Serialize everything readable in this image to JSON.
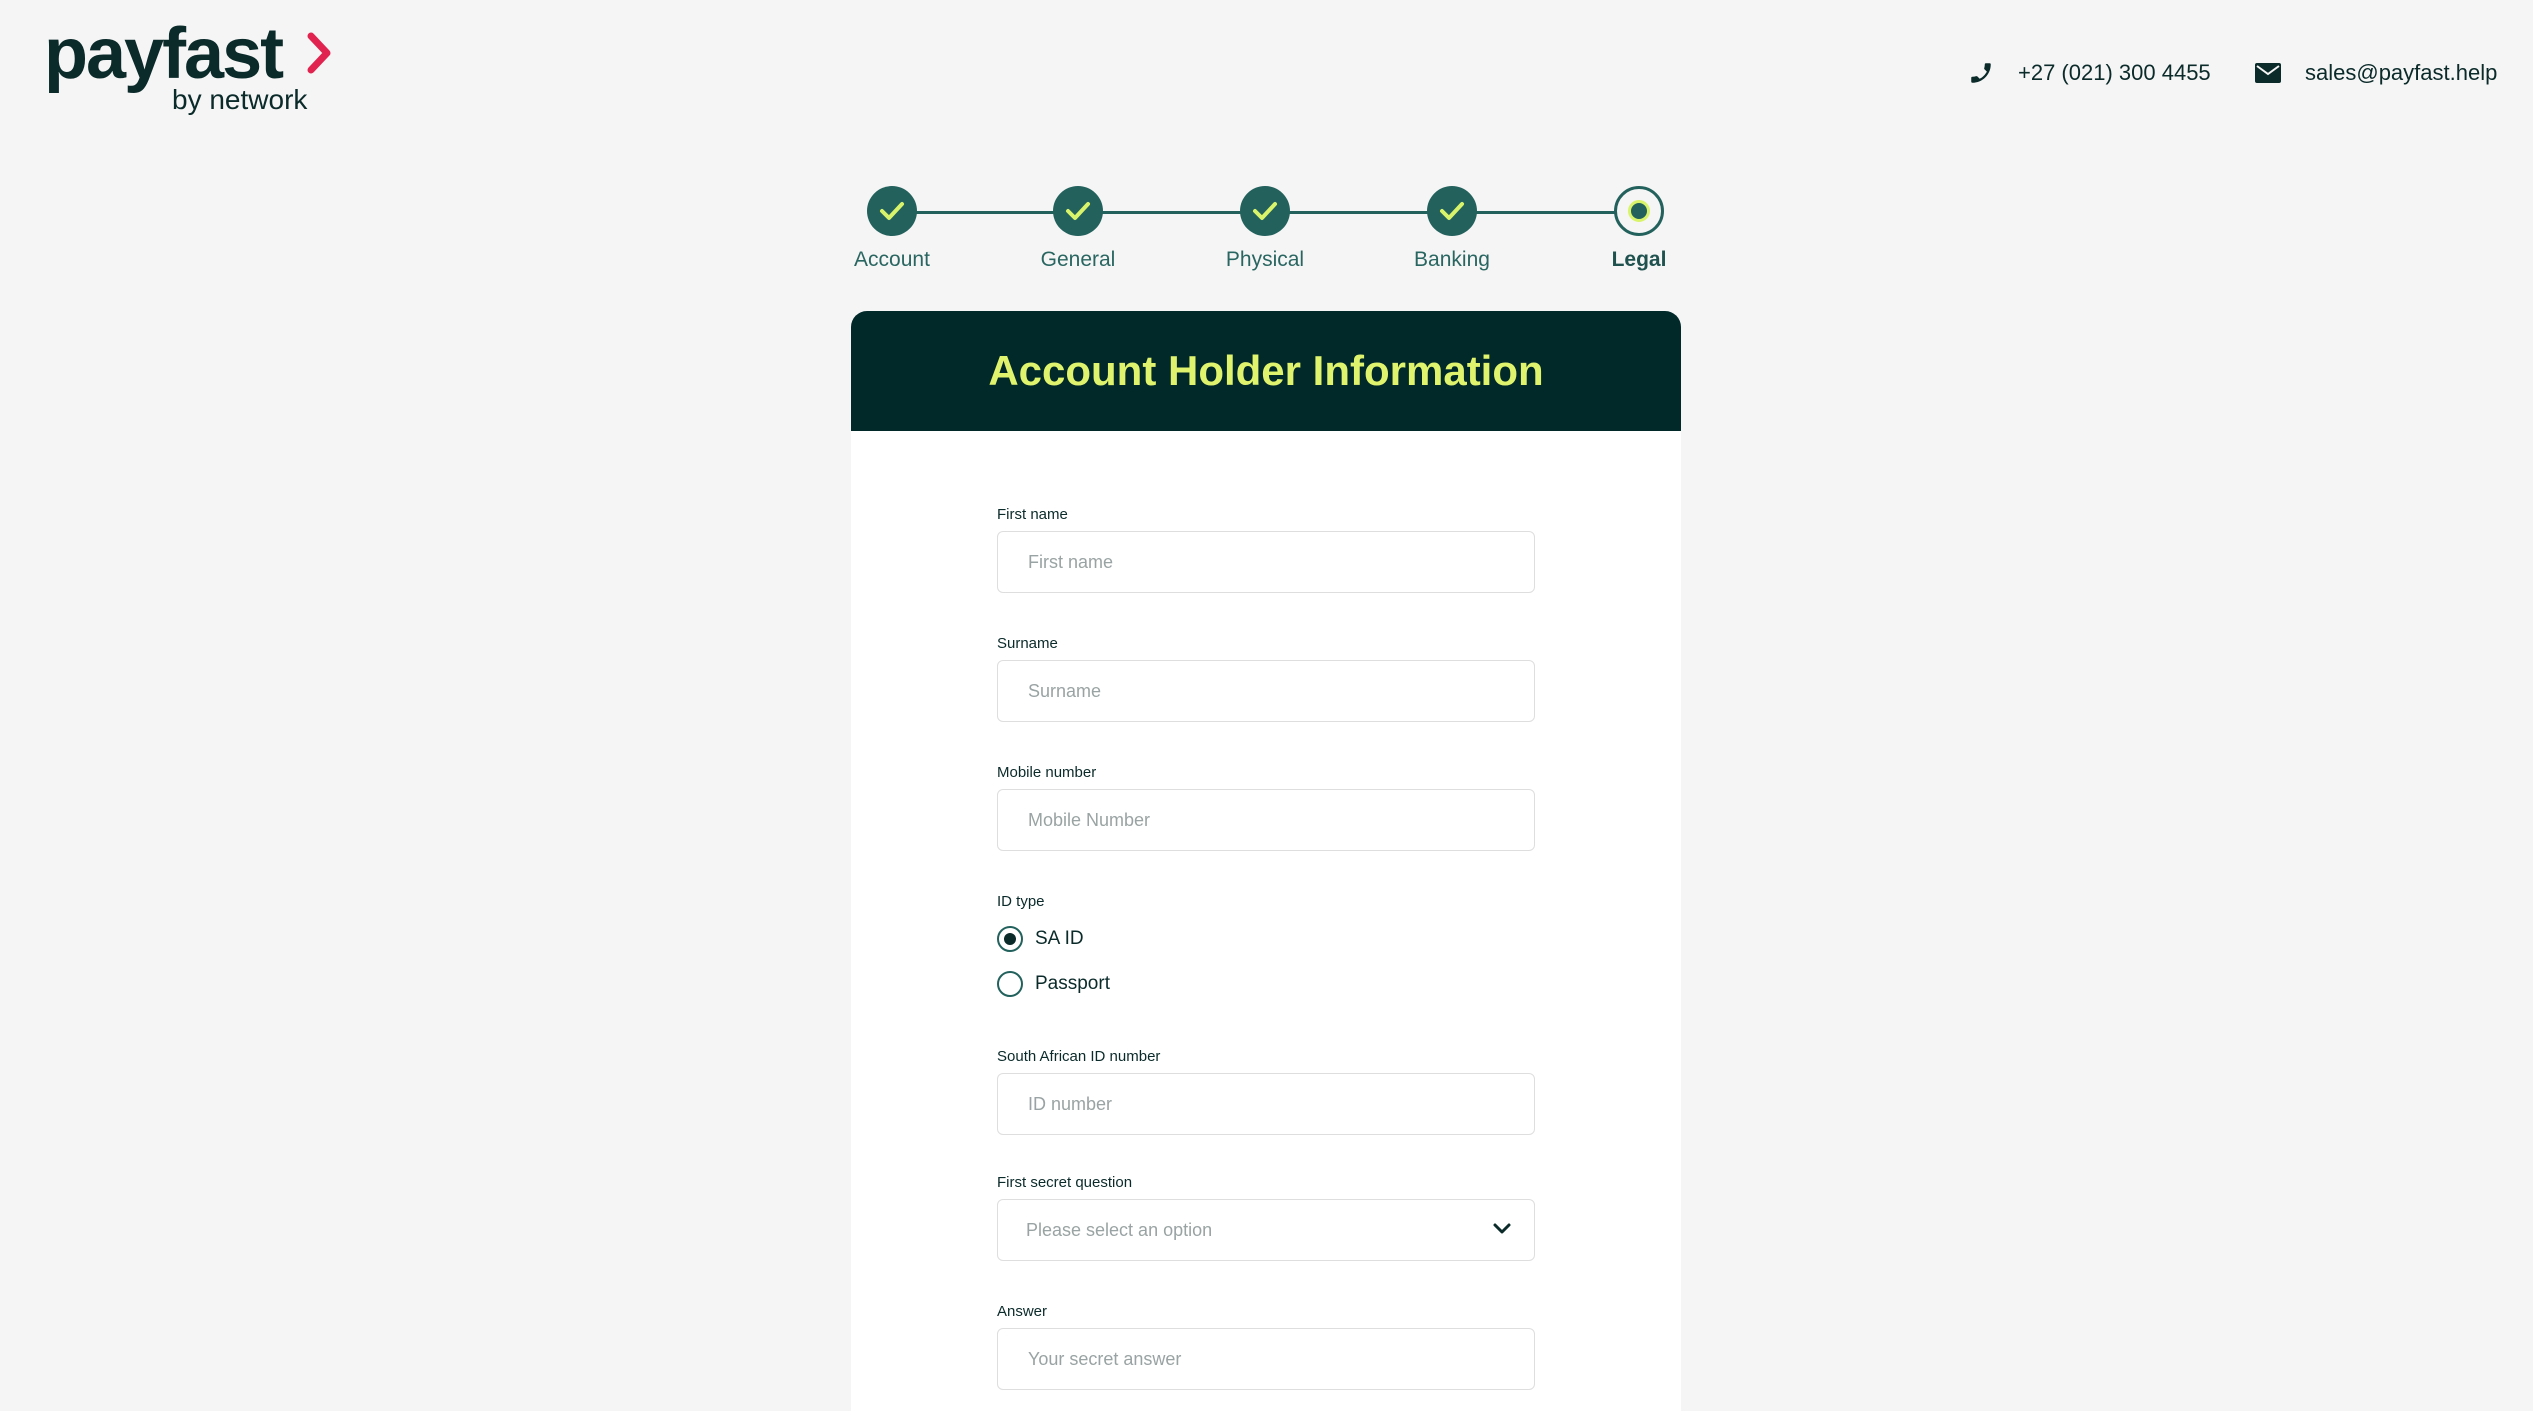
{
  "brand": {
    "name": "payfast",
    "tagline": "by network",
    "accent": "#e0244f",
    "primary": "#02292a",
    "highlight": "#dff36c"
  },
  "header": {
    "phone": "+27 (021) 300 4455",
    "email": "sales@payfast.help"
  },
  "stepper": {
    "steps": [
      {
        "label": "Account",
        "state": "complete"
      },
      {
        "label": "General",
        "state": "complete"
      },
      {
        "label": "Physical",
        "state": "complete"
      },
      {
        "label": "Banking",
        "state": "complete"
      },
      {
        "label": "Legal",
        "state": "current"
      }
    ]
  },
  "card": {
    "title": "Account Holder Information",
    "fields": {
      "first_name": {
        "label": "First name",
        "placeholder": "First name",
        "value": ""
      },
      "surname": {
        "label": "Surname",
        "placeholder": "Surname",
        "value": ""
      },
      "mobile": {
        "label": "Mobile number",
        "placeholder": "Mobile Number",
        "value": ""
      },
      "id_type": {
        "label": "ID type",
        "options": [
          {
            "label": "SA ID",
            "selected": true
          },
          {
            "label": "Passport",
            "selected": false
          }
        ]
      },
      "id_number": {
        "label": "South African ID number",
        "placeholder": "ID number",
        "value": ""
      },
      "secret_question": {
        "label": "First secret question",
        "selected": "Please select an option"
      },
      "answer": {
        "label": "Answer",
        "placeholder": "Your secret answer",
        "value": ""
      }
    }
  },
  "icons": {
    "phone": "phone-icon",
    "email": "envelope-icon",
    "check": "check-icon",
    "dropdown": "chevron-down-icon"
  }
}
